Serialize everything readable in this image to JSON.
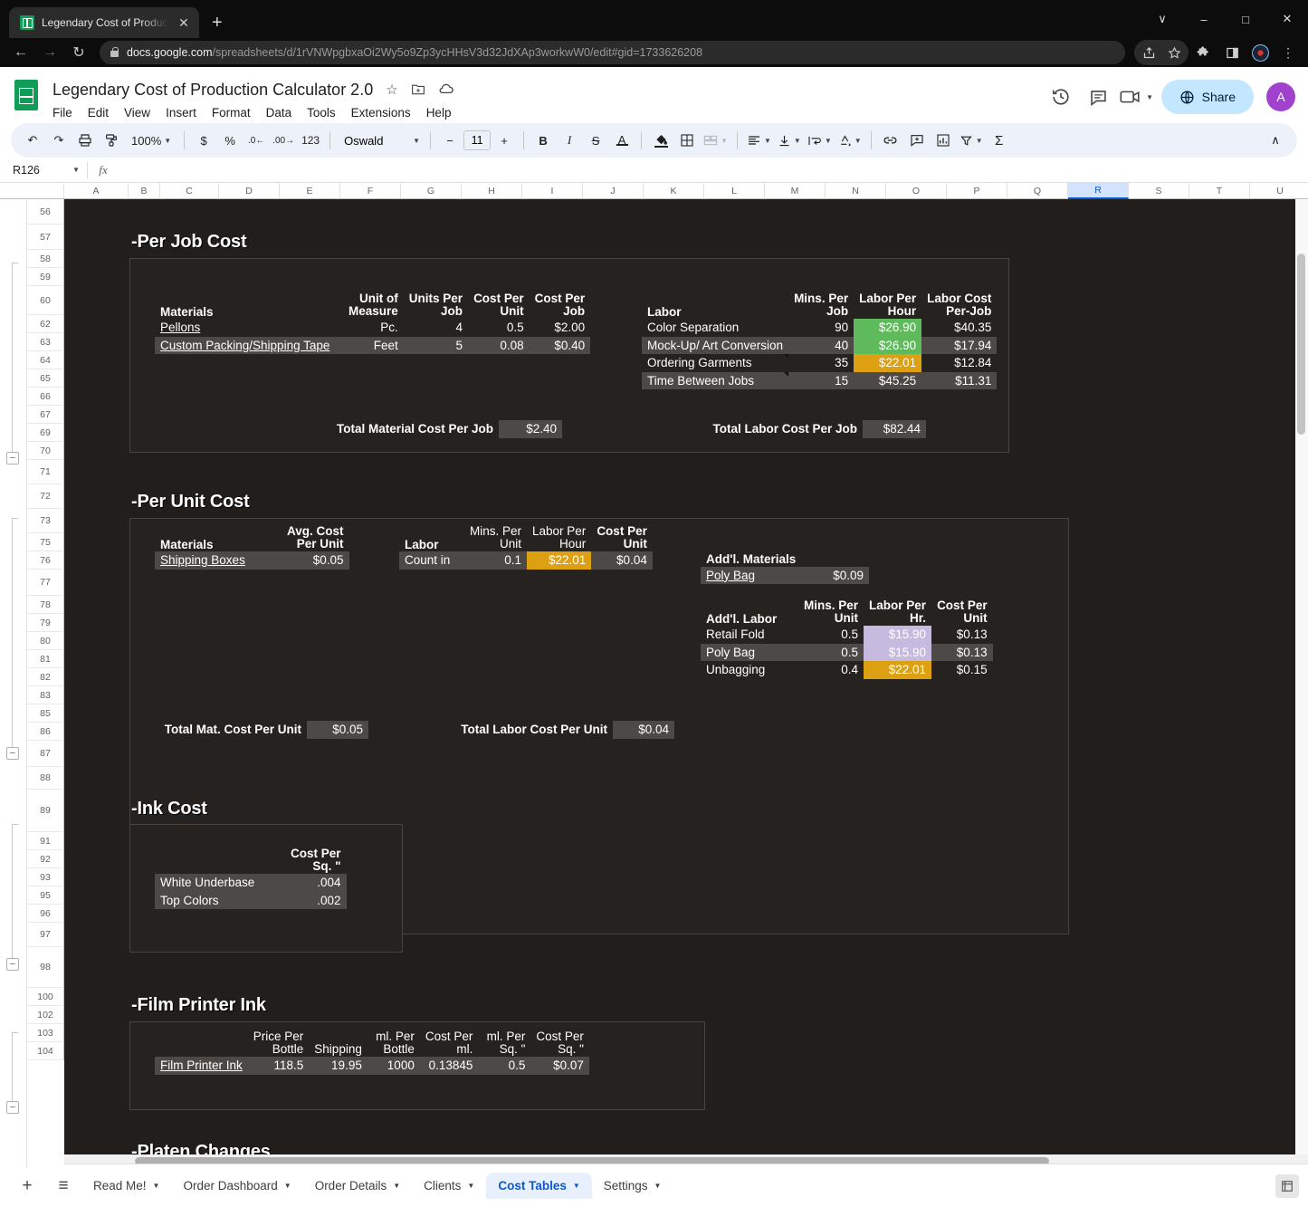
{
  "browser": {
    "tab_title": "Legendary Cost of Production Ca",
    "tab_close": "✕",
    "new_tab": "+",
    "window": {
      "collapse": "∨",
      "minimize": "–",
      "maximize": "□",
      "close": "✕"
    },
    "nav": {
      "back": "←",
      "forward": "→",
      "reload": "↻"
    },
    "url_host": "docs.google.com",
    "url_path": "/spreadsheets/d/1rVNWpgbxaOi2Wy5o9Zp3ycHHsV3d32JdXAp3workwW0/edit#gid=1733626208",
    "omni_icons": [
      "share-icon",
      "star-icon",
      "extensions-icon",
      "side-panel-icon",
      "profile-icon",
      "more-icon"
    ]
  },
  "app": {
    "doc_title": "Legendary Cost of Production Calculator 2.0",
    "title_icons": [
      "star-icon",
      "move-to-folder-icon",
      "cloud-saved-icon"
    ],
    "menus": [
      "File",
      "Edit",
      "View",
      "Insert",
      "Format",
      "Data",
      "Tools",
      "Extensions",
      "Help"
    ],
    "header_right_icons": [
      "version-history-icon",
      "comment-icon",
      "meet-icon"
    ],
    "share_label": "Share",
    "avatar_letter": "A"
  },
  "toolbar": {
    "undo": "↶",
    "redo": "↷",
    "print": "⎙",
    "paint_format": "❐",
    "zoom": "100%",
    "currency": "$",
    "percent": "%",
    "decrease_decimal": ".0",
    "increase_decimal": ".00",
    "more_formats": "123",
    "font_family": "Oswald",
    "font_decrease": "−",
    "font_size": "11",
    "font_increase": "+",
    "bold": "B",
    "italic": "I",
    "strikethrough": "S",
    "text_color": "A",
    "fill_color": "fill-color-icon",
    "borders": "borders-icon",
    "merge_cells": "merge-cells-icon",
    "align": "align-icon",
    "valign": "vertical-align-icon",
    "text_wrap": "text-wrap-icon",
    "text_rotation": "text-rotation-icon",
    "insert_link": "link-icon",
    "insert_comment": "add-comment-icon",
    "insert_chart": "insert-chart-icon",
    "filter": "filter-icon",
    "functions": "Σ",
    "collapse": "∧"
  },
  "formula_bar": {
    "name_box": "R126",
    "fx": "fx",
    "value": ""
  },
  "grid": {
    "columns": [
      "A",
      "B",
      "C",
      "D",
      "E",
      "F",
      "G",
      "H",
      "I",
      "J",
      "K",
      "L",
      "M",
      "N",
      "O",
      "P",
      "Q",
      "R",
      "S",
      "T",
      "U"
    ],
    "selected_column": "R",
    "rows": [
      "56",
      "57",
      "58",
      "59",
      "60",
      "62",
      "63",
      "64",
      "65",
      "66",
      "67",
      "69",
      "70",
      "71",
      "72",
      "73",
      "75",
      "76",
      "77",
      "78",
      "79",
      "80",
      "81",
      "82",
      "83",
      "85",
      "86",
      "87",
      "88",
      "89",
      "91",
      "92",
      "93",
      "95",
      "96",
      "97",
      "98",
      "100",
      "102",
      "103",
      "104"
    ],
    "group_collapse_symbol": "−"
  },
  "sheet": {
    "sections": {
      "per_job": {
        "title": "-Per Job Cost",
        "materials": {
          "headers": [
            "Materials",
            "Unit of Measure",
            "Units Per Job",
            "Cost Per Unit",
            "Cost Per Job"
          ],
          "rows": [
            {
              "name": "Pellons",
              "uom": "Pc.",
              "units": "4",
              "cost_unit": "0.5",
              "cost_job": "$2.00"
            },
            {
              "name": "Custom Packing/Shipping Tape",
              "uom": "Feet",
              "units": "5",
              "cost_unit": "0.08",
              "cost_job": "$0.40"
            }
          ],
          "total_label": "Total Material Cost Per Job",
          "total_value": "$2.40"
        },
        "labor": {
          "headers": [
            "Labor",
            "Mins. Per Job",
            "Labor Per Hour",
            "Labor Cost Per-Job"
          ],
          "rows": [
            {
              "name": "Color Separation",
              "mins": "90",
              "rate": "$26.90",
              "cost": "$40.35",
              "rate_fill": "green",
              "comment": false
            },
            {
              "name": "Mock-Up/ Art Conversion",
              "mins": "40",
              "rate": "$26.90",
              "cost": "$17.94",
              "rate_fill": "green",
              "comment": false
            },
            {
              "name": "Ordering Garments",
              "mins": "35",
              "rate": "$22.01",
              "cost": "$12.84",
              "rate_fill": "orange",
              "comment": true
            },
            {
              "name": "Time Between Jobs",
              "mins": "15",
              "rate": "$45.25",
              "cost": "$11.31",
              "rate_fill": "none",
              "comment": true
            }
          ],
          "total_label": "Total Labor Cost Per Job",
          "total_value": "$82.44"
        }
      },
      "per_unit": {
        "title": "-Per Unit Cost",
        "materials": {
          "headers": [
            "Materials",
            "Avg. Cost Per Unit"
          ],
          "rows": [
            {
              "name": "Shipping Boxes",
              "cost": "$0.05"
            }
          ],
          "total_label": "Total Mat. Cost Per Unit",
          "total_value": "$0.05"
        },
        "labor": {
          "headers": [
            "Labor",
            "Mins. Per Unit",
            "Labor Per Hour",
            "Cost Per Unit"
          ],
          "rows": [
            {
              "name": "Count in",
              "mins": "0.1",
              "rate": "$22.01",
              "cost": "$0.04",
              "rate_fill": "orange"
            }
          ],
          "total_label": "Total Labor Cost Per Unit",
          "total_value": "$0.04"
        },
        "addl_materials": {
          "title": "Add'l. Materials",
          "rows": [
            {
              "name": "Poly Bag",
              "cost": "$0.09"
            }
          ]
        },
        "addl_labor": {
          "headers": [
            "Add'l. Labor",
            "Mins. Per Unit",
            "Labor Per Hr.",
            "Cost Per Unit"
          ],
          "rows": [
            {
              "name": "Retail Fold",
              "mins": "0.5",
              "rate": "$15.90",
              "cost": "$0.13",
              "rate_fill": "purple"
            },
            {
              "name": "Poly Bag",
              "mins": "0.5",
              "rate": "$15.90",
              "cost": "$0.13",
              "rate_fill": "purple"
            },
            {
              "name": "Unbagging",
              "mins": "0.4",
              "rate": "$22.01",
              "cost": "$0.15",
              "rate_fill": "orange"
            }
          ]
        }
      },
      "ink_cost": {
        "title": "-Ink Cost",
        "headers": [
          "",
          "Cost Per Sq. \""
        ],
        "rows": [
          {
            "name": "White Underbase",
            "cost": ".004"
          },
          {
            "name": "Top Colors",
            "cost": ".002"
          }
        ]
      },
      "film_printer_ink": {
        "title": "-Film Printer Ink",
        "headers": [
          "",
          "Price Per Bottle",
          "Shipping",
          "ml. Per Bottle",
          "Cost Per ml.",
          "ml. Per Sq. \"",
          "Cost Per Sq. \""
        ],
        "rows": [
          {
            "name": "Film Printer Ink",
            "price": "118.5",
            "shipping": "19.95",
            "ml_bottle": "1000",
            "cost_ml": "0.13845",
            "ml_sq": "0.5",
            "cost_sq": "$0.07"
          }
        ]
      },
      "platen_changes": {
        "title": "-Platen Changes"
      }
    }
  },
  "sheet_tabs": {
    "add": "+",
    "all_sheets": "≡",
    "tabs": [
      {
        "label": "Read Me!",
        "active": false
      },
      {
        "label": "Order Dashboard",
        "active": false
      },
      {
        "label": "Order Details",
        "active": false
      },
      {
        "label": "Clients",
        "active": false
      },
      {
        "label": "Cost Tables",
        "active": true
      },
      {
        "label": "Settings",
        "active": false
      }
    ],
    "explore": "explore-icon"
  },
  "colors": {
    "sheet_bg": "#221e1c",
    "panel_bg": "#262220",
    "band": "#4d4946",
    "green": "#5fba5c",
    "orange": "#dda012",
    "purple": "#c6bade",
    "accent_blue": "#0b57d0",
    "share_bg": "#c2e7ff",
    "avatar": "#a142cf"
  }
}
